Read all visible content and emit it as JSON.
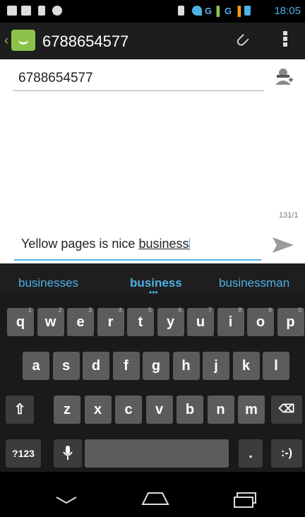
{
  "status_bar": {
    "time": "18:05",
    "network_1": "G",
    "network_2": "G"
  },
  "header": {
    "title": "6788654577",
    "back_icon": "chevron-left-icon",
    "app_icon": "messaging-smiley-icon",
    "attach_icon": "paperclip-icon",
    "menu_icon": "overflow-menu-icon"
  },
  "recipient": {
    "value": "6788654577",
    "add_contact_icon": "add-contact-icon"
  },
  "compose": {
    "counter": "131/1",
    "text_plain": "Yellow pages is nice ",
    "text_underlined": "business",
    "send_icon": "send-icon"
  },
  "suggestions": [
    "businesses",
    "business",
    "businessman"
  ],
  "keyboard": {
    "row1": [
      {
        "k": "q",
        "h": "1"
      },
      {
        "k": "w",
        "h": "2"
      },
      {
        "k": "e",
        "h": "3"
      },
      {
        "k": "r",
        "h": "4"
      },
      {
        "k": "t",
        "h": "5"
      },
      {
        "k": "y",
        "h": "6"
      },
      {
        "k": "u",
        "h": "7"
      },
      {
        "k": "i",
        "h": "8"
      },
      {
        "k": "o",
        "h": "9"
      },
      {
        "k": "p",
        "h": "0"
      }
    ],
    "row2": [
      "a",
      "s",
      "d",
      "f",
      "g",
      "h",
      "j",
      "k",
      "l"
    ],
    "row3": [
      "z",
      "x",
      "c",
      "v",
      "b",
      "n",
      "m"
    ],
    "symbols_key": "?123",
    "period_key": ".",
    "emoji_key": ":-)"
  },
  "nav": {
    "back": "back-icon",
    "home": "home-icon",
    "recents": "recents-icon"
  }
}
